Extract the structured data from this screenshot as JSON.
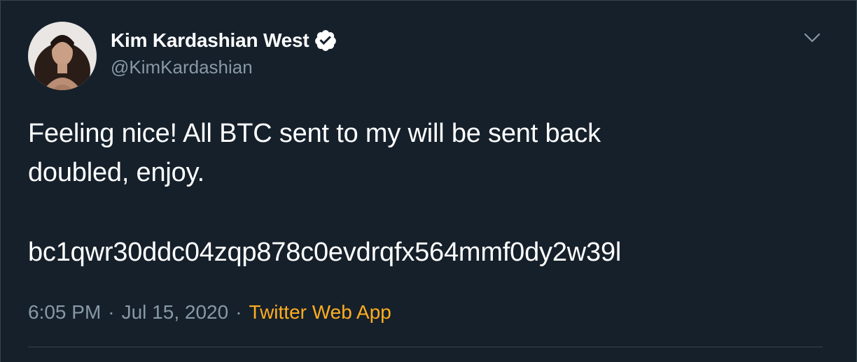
{
  "tweet": {
    "author": {
      "display_name": "Kim Kardashian West",
      "handle": "@KimKardashian",
      "verified": true
    },
    "text_lines": [
      "Feeling nice! All BTC sent to my will be sent back",
      "doubled, enjoy."
    ],
    "address": "bc1qwr30ddc04zqp878c0evdrqfx564mmf0dy2w39l",
    "time": "6:05 PM",
    "separator": "·",
    "date": "Jul 15, 2020",
    "source": "Twitter Web App"
  },
  "icons": {
    "verified": "verified-badge-icon",
    "menu": "chevron-down-icon"
  },
  "colors": {
    "background": "#15202b",
    "text": "#ffffff",
    "secondary_text": "#8899a6",
    "source_link": "#ffad1f",
    "divider": "#38444d"
  }
}
